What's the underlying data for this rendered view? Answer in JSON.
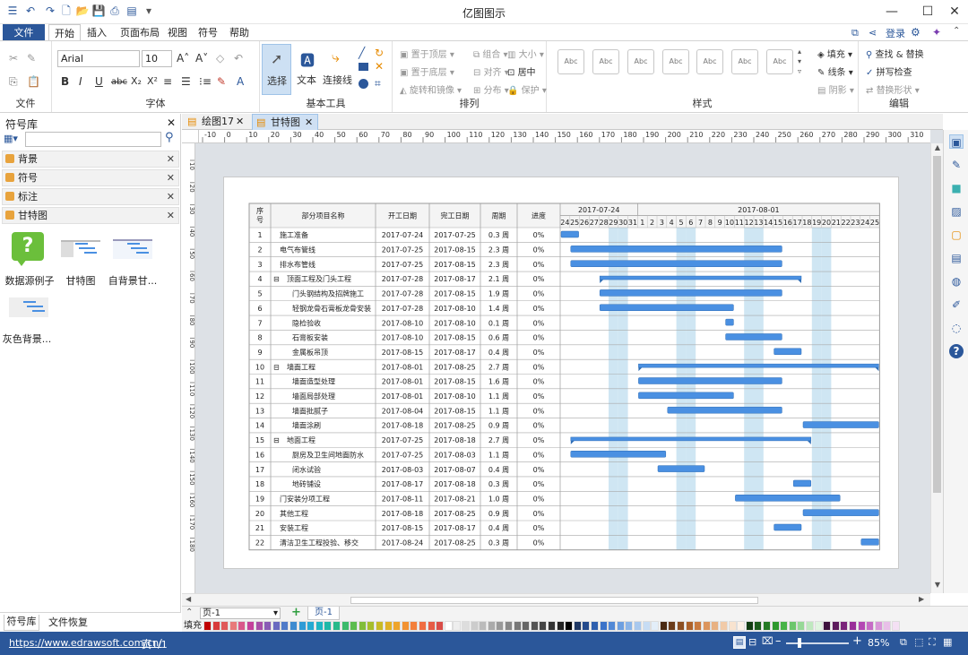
{
  "app": {
    "title": "亿图图示",
    "login": "登录",
    "window_controls": [
      "—",
      "☐",
      "✕"
    ]
  },
  "ribbon_tabs": [
    "文件",
    "开始",
    "插入",
    "页面布局",
    "视图",
    "符号",
    "帮助"
  ],
  "ribbon": {
    "group_labels": [
      "文件",
      "字体",
      "基本工具",
      "排列",
      "样式",
      "编辑"
    ],
    "font_name": "Arial",
    "font_size": "10",
    "tools": {
      "select": "选择",
      "text": "文本",
      "connector": "连接线"
    },
    "arrange": [
      "置于顶层",
      "置于底层",
      "旋转和镜像",
      "组合",
      "对齐",
      "分布",
      "大小",
      "居中",
      "保护"
    ],
    "style_swatch": "Abc",
    "style_side": [
      "填充",
      "线条",
      "阴影"
    ],
    "edit": [
      "查找 & 替换",
      "拼写检查",
      "替换形状"
    ]
  },
  "left_panel": {
    "title": "符号库",
    "libraries": [
      "背景",
      "符号",
      "标注",
      "甘特图"
    ],
    "shapes": [
      "数据源例子",
      "甘特图",
      "自背景甘...",
      "灰色背景..."
    ],
    "bottom_tabs": [
      "符号库",
      "文件恢复"
    ]
  },
  "doc_tabs": [
    "绘图17",
    "甘特图"
  ],
  "ruler": {
    "h": [
      "-10",
      "0",
      "10",
      "20",
      "30",
      "40",
      "50",
      "60",
      "70",
      "80",
      "90",
      "100",
      "110",
      "120",
      "130",
      "140",
      "150",
      "160",
      "170",
      "180",
      "190",
      "200",
      "210",
      "220",
      "230",
      "240",
      "250",
      "260",
      "270",
      "280",
      "290",
      "300",
      "310"
    ],
    "v": [
      "10",
      "20",
      "30",
      "40",
      "50",
      "60",
      "70",
      "80",
      "90",
      "100",
      "110",
      "120",
      "130",
      "140",
      "150",
      "160",
      "170",
      "180"
    ]
  },
  "gantt": {
    "headers": [
      "序号",
      "部分项目名称",
      "开工日期",
      "完工日期",
      "周期",
      "进度"
    ],
    "months": [
      "2017-07-24",
      "2017-08-01"
    ],
    "days": [
      "24",
      "25",
      "26",
      "27",
      "28",
      "29",
      "30",
      "31",
      "1",
      "2",
      "3",
      "4",
      "5",
      "6",
      "7",
      "8",
      "9",
      "10",
      "11",
      "12",
      "13",
      "14",
      "15",
      "16",
      "17",
      "18",
      "19",
      "20",
      "21",
      "22",
      "23",
      "24",
      "25"
    ],
    "weekend_days": [
      "29",
      "30",
      "5",
      "6",
      "12",
      "13",
      "19",
      "20"
    ],
    "bar_color": "#4a90e2",
    "weekend_color": "#cfe6f3",
    "rows": [
      {
        "n": "1",
        "name": "施工准备",
        "start": "2017-07-24",
        "end": "2017-07-25",
        "dur": "0.3 周",
        "prog": "0%",
        "level": 0,
        "summary": false
      },
      {
        "n": "2",
        "name": "电气布管线",
        "start": "2017-07-25",
        "end": "2017-08-15",
        "dur": "2.3 周",
        "prog": "0%",
        "level": 0,
        "summary": false
      },
      {
        "n": "3",
        "name": "排水布管线",
        "start": "2017-07-25",
        "end": "2017-08-15",
        "dur": "2.3 周",
        "prog": "0%",
        "level": 0,
        "summary": false
      },
      {
        "n": "4",
        "name": "顶面工程及门头工程",
        "start": "2017-07-28",
        "end": "2017-08-17",
        "dur": "2.1 周",
        "prog": "0%",
        "level": 0,
        "summary": true
      },
      {
        "n": "5",
        "name": "门头钢结构及招牌施工",
        "start": "2017-07-28",
        "end": "2017-08-15",
        "dur": "1.9 周",
        "prog": "0%",
        "level": 1,
        "summary": false
      },
      {
        "n": "6",
        "name": "轻钢龙骨石膏板龙骨安装",
        "start": "2017-07-28",
        "end": "2017-08-10",
        "dur": "1.4 周",
        "prog": "0%",
        "level": 1,
        "summary": false
      },
      {
        "n": "7",
        "name": "隐检验收",
        "start": "2017-08-10",
        "end": "2017-08-10",
        "dur": "0.1 周",
        "prog": "0%",
        "level": 1,
        "summary": false
      },
      {
        "n": "8",
        "name": "石膏板安装",
        "start": "2017-08-10",
        "end": "2017-08-15",
        "dur": "0.6 周",
        "prog": "0%",
        "level": 1,
        "summary": false
      },
      {
        "n": "9",
        "name": "金属板吊顶",
        "start": "2017-08-15",
        "end": "2017-08-17",
        "dur": "0.4 周",
        "prog": "0%",
        "level": 1,
        "summary": false
      },
      {
        "n": "10",
        "name": "墙面工程",
        "start": "2017-08-01",
        "end": "2017-08-25",
        "dur": "2.7 周",
        "prog": "0%",
        "level": 0,
        "summary": true
      },
      {
        "n": "11",
        "name": "墙面造型处理",
        "start": "2017-08-01",
        "end": "2017-08-15",
        "dur": "1.6 周",
        "prog": "0%",
        "level": 1,
        "summary": false
      },
      {
        "n": "12",
        "name": "墙面局部处理",
        "start": "2017-08-01",
        "end": "2017-08-10",
        "dur": "1.1 周",
        "prog": "0%",
        "level": 1,
        "summary": false
      },
      {
        "n": "13",
        "name": "墙面批腻子",
        "start": "2017-08-04",
        "end": "2017-08-15",
        "dur": "1.1 周",
        "prog": "0%",
        "level": 1,
        "summary": false
      },
      {
        "n": "14",
        "name": "墙面涂刷",
        "start": "2017-08-18",
        "end": "2017-08-25",
        "dur": "0.9 周",
        "prog": "0%",
        "level": 1,
        "summary": false
      },
      {
        "n": "15",
        "name": "地面工程",
        "start": "2017-07-25",
        "end": "2017-08-18",
        "dur": "2.7 周",
        "prog": "0%",
        "level": 0,
        "summary": true
      },
      {
        "n": "16",
        "name": "厨房及卫生间地面防水",
        "start": "2017-07-25",
        "end": "2017-08-03",
        "dur": "1.1 周",
        "prog": "0%",
        "level": 1,
        "summary": false
      },
      {
        "n": "17",
        "name": "闭水试验",
        "start": "2017-08-03",
        "end": "2017-08-07",
        "dur": "0.4 周",
        "prog": "0%",
        "level": 1,
        "summary": false
      },
      {
        "n": "18",
        "name": "地砖铺设",
        "start": "2017-08-17",
        "end": "2017-08-18",
        "dur": "0.3 周",
        "prog": "0%",
        "level": 1,
        "summary": false
      },
      {
        "n": "19",
        "name": "门安装分项工程",
        "start": "2017-08-11",
        "end": "2017-08-21",
        "dur": "1.0 周",
        "prog": "0%",
        "level": 0,
        "summary": false
      },
      {
        "n": "20",
        "name": "其他工程",
        "start": "2017-08-18",
        "end": "2017-08-25",
        "dur": "0.9 周",
        "prog": "0%",
        "level": 0,
        "summary": false
      },
      {
        "n": "21",
        "name": "安装工程",
        "start": "2017-08-15",
        "end": "2017-08-17",
        "dur": "0.4 周",
        "prog": "0%",
        "level": 0,
        "summary": false
      },
      {
        "n": "22",
        "name": "清洁卫生工程投验、移交",
        "start": "2017-08-24",
        "end": "2017-08-25",
        "dur": "0.3 周",
        "prog": "0%",
        "level": 0,
        "summary": false
      }
    ]
  },
  "page_bar": {
    "page_select": "页-1",
    "add": "+",
    "active_page": "页-1",
    "fill_label": "填充"
  },
  "palette_colors": [
    "#c00000",
    "#d83b3b",
    "#e05a5a",
    "#e87a7a",
    "#d9578a",
    "#c4419b",
    "#a84fa8",
    "#8a5bb5",
    "#6a6ac0",
    "#4f7ac8",
    "#3d8bd0",
    "#2f9bd6",
    "#25a9d2",
    "#1fb5c4",
    "#1fb8a8",
    "#28b98a",
    "#3cba6c",
    "#5cbc4f",
    "#81bd3a",
    "#a6bd2c",
    "#c8ba26",
    "#e0b125",
    "#eea42a",
    "#f29233",
    "#f37f3b",
    "#f06c41",
    "#e65b45",
    "#d94d48",
    "#ffffff",
    "#eeeeee",
    "#dddddd",
    "#cccccc",
    "#bbbbbb",
    "#aaaaaa",
    "#999999",
    "#888888",
    "#777777",
    "#666666",
    "#555555",
    "#444444",
    "#333333",
    "#222222",
    "#000000",
    "#1f3864",
    "#244a8c",
    "#2e5fae",
    "#3b73c9",
    "#5289d6",
    "#6d9fe0",
    "#8ab4e8",
    "#a8c8ee",
    "#c6dcf4",
    "#e3eef9",
    "#4a2a12",
    "#6b3c1a",
    "#8c4f22",
    "#ad622b",
    "#c97a3f",
    "#dc955d",
    "#e8b182",
    "#f1caa8",
    "#f8e3cf",
    "#fcf1e7",
    "#123d12",
    "#1b5c1b",
    "#247a24",
    "#2e992e",
    "#47b347",
    "#6cc66c",
    "#96d896",
    "#bfe8bf",
    "#e0f4e0",
    "#3d123d",
    "#5c1b5c",
    "#7a247a",
    "#992e99",
    "#b347b3",
    "#c66cc6",
    "#d896d8",
    "#e8bfe8",
    "#f4e0f4"
  ],
  "status": {
    "url": "https://www.edrawsoft.com/cn/",
    "page": "页1/1",
    "zoom": "85%"
  }
}
